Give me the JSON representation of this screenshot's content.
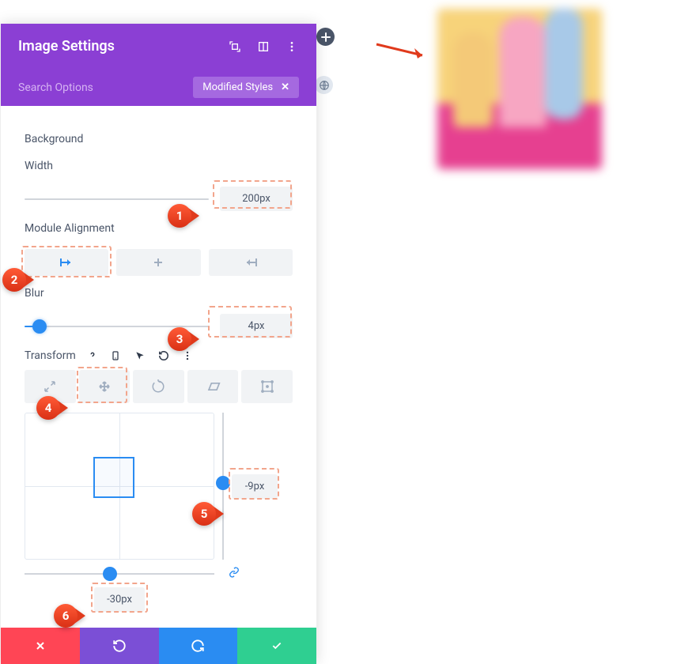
{
  "header": {
    "title": "Image Settings"
  },
  "search": {
    "placeholder": "Search Options",
    "filter_label": "Modified Styles"
  },
  "sections": {
    "background_label": "Background",
    "width_label": "Width",
    "width_value": "200px",
    "module_alignment_label": "Module Alignment",
    "blur_label": "Blur",
    "blur_value": "4px",
    "transform_label": "Transform",
    "transform_y_value": "-9px",
    "transform_x_value": "-30px"
  },
  "callouts": {
    "c1": "1",
    "c2": "2",
    "c3": "3",
    "c4": "4",
    "c5": "5",
    "c6": "6"
  }
}
